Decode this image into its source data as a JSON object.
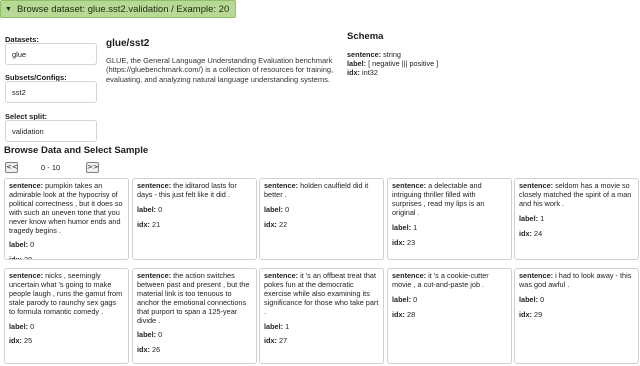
{
  "header": {
    "expander_label": "Browse dataset: glue.sst2.validation / Example: 20"
  },
  "sidebar": {
    "datasets_label": "Datasets:",
    "datasets_value": "glue",
    "configs_label": "Subsets/Configs:",
    "configs_value": "sst2",
    "split_label": "Select split:",
    "split_value": "validation"
  },
  "dataset": {
    "title": "glue/sst2",
    "description": "GLUE, the General Language Understanding Evaluation benchmark (https://gluebenchmark.com/) is a collection of resources for training, evaluating, and analyzing natural language understanding systems."
  },
  "schema": {
    "title": "Schema",
    "fields": [
      {
        "key": "sentence:",
        "value": "string"
      },
      {
        "key": "label:",
        "value": "[ negative ||| positive ]"
      },
      {
        "key": "idx:",
        "value": "int32"
      }
    ]
  },
  "browse": {
    "title": "Browse Data and Select Sample",
    "prev": "<<",
    "next": ">>",
    "range": "0 - 10"
  },
  "keys": {
    "sentence": "sentence:",
    "label": "label:",
    "idx": "idx:"
  },
  "samples": [
    {
      "sentence": "pumpkin takes an admirable look at the hypocrisy of political correctness , but it does so with such an uneven tone that you never know when humor ends and tragedy begins .",
      "label": "0",
      "idx": "20"
    },
    {
      "sentence": "the iditarod lasts for days - this just felt like it did .",
      "label": "0",
      "idx": "21"
    },
    {
      "sentence": "holden caulfield did it better .",
      "label": "0",
      "idx": "22"
    },
    {
      "sentence": "a delectable and intriguing thriller filled with surprises , read my lips is an original .",
      "label": "1",
      "idx": "23"
    },
    {
      "sentence": "seldom has a movie so closely matched the spirit of a man and his work .",
      "label": "1",
      "idx": "24"
    },
    {
      "sentence": "nicks , seemingly uncertain what 's going to make people laugh , runs the gamut from stale parody to raunchy sex gags to formula romantic comedy .",
      "label": "0",
      "idx": "25"
    },
    {
      "sentence": "the action switches between past and present , but the material link is too tenuous to anchor the emotional connections that purport to span a 125-year divide .",
      "label": "0",
      "idx": "26"
    },
    {
      "sentence": "it 's an offbeat treat that pokes fun at the democratic exercise while also examining its significance for those who take part .",
      "label": "1",
      "idx": "27"
    },
    {
      "sentence": "it 's a cookie-cutter movie , a cut-and-paste job .",
      "label": "0",
      "idx": "28"
    },
    {
      "sentence": "i had to look away - this was god awful .",
      "label": "0",
      "idx": "29"
    }
  ]
}
